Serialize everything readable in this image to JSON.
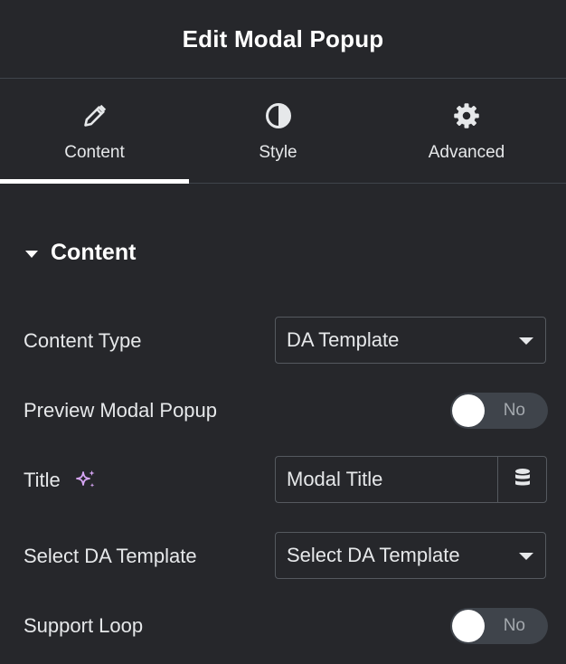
{
  "header": {
    "title": "Edit Modal Popup"
  },
  "tabs": [
    {
      "label": "Content",
      "icon": "pencil-icon",
      "active": true
    },
    {
      "label": "Style",
      "icon": "half-circle-icon",
      "active": false
    },
    {
      "label": "Advanced",
      "icon": "gear-icon",
      "active": false
    }
  ],
  "section": {
    "title": "Content",
    "icon": "caret-down-icon"
  },
  "fields": {
    "content_type": {
      "label": "Content Type",
      "value": "DA Template"
    },
    "preview_modal": {
      "label": "Preview Modal Popup",
      "toggle_text": "No"
    },
    "title": {
      "label": "Title",
      "value": "Modal Title",
      "ai_icon": "sparkle-icon",
      "dynamic_icon": "database-icon"
    },
    "select_template": {
      "label": "Select DA Template",
      "value": "Select DA Template"
    },
    "support_loop": {
      "label": "Support Loop",
      "toggle_text": "No"
    }
  },
  "colors": {
    "background": "#26272b",
    "border": "#3f444b",
    "text": "#e6e8ea",
    "ai_accent": "#d7a6f5"
  }
}
